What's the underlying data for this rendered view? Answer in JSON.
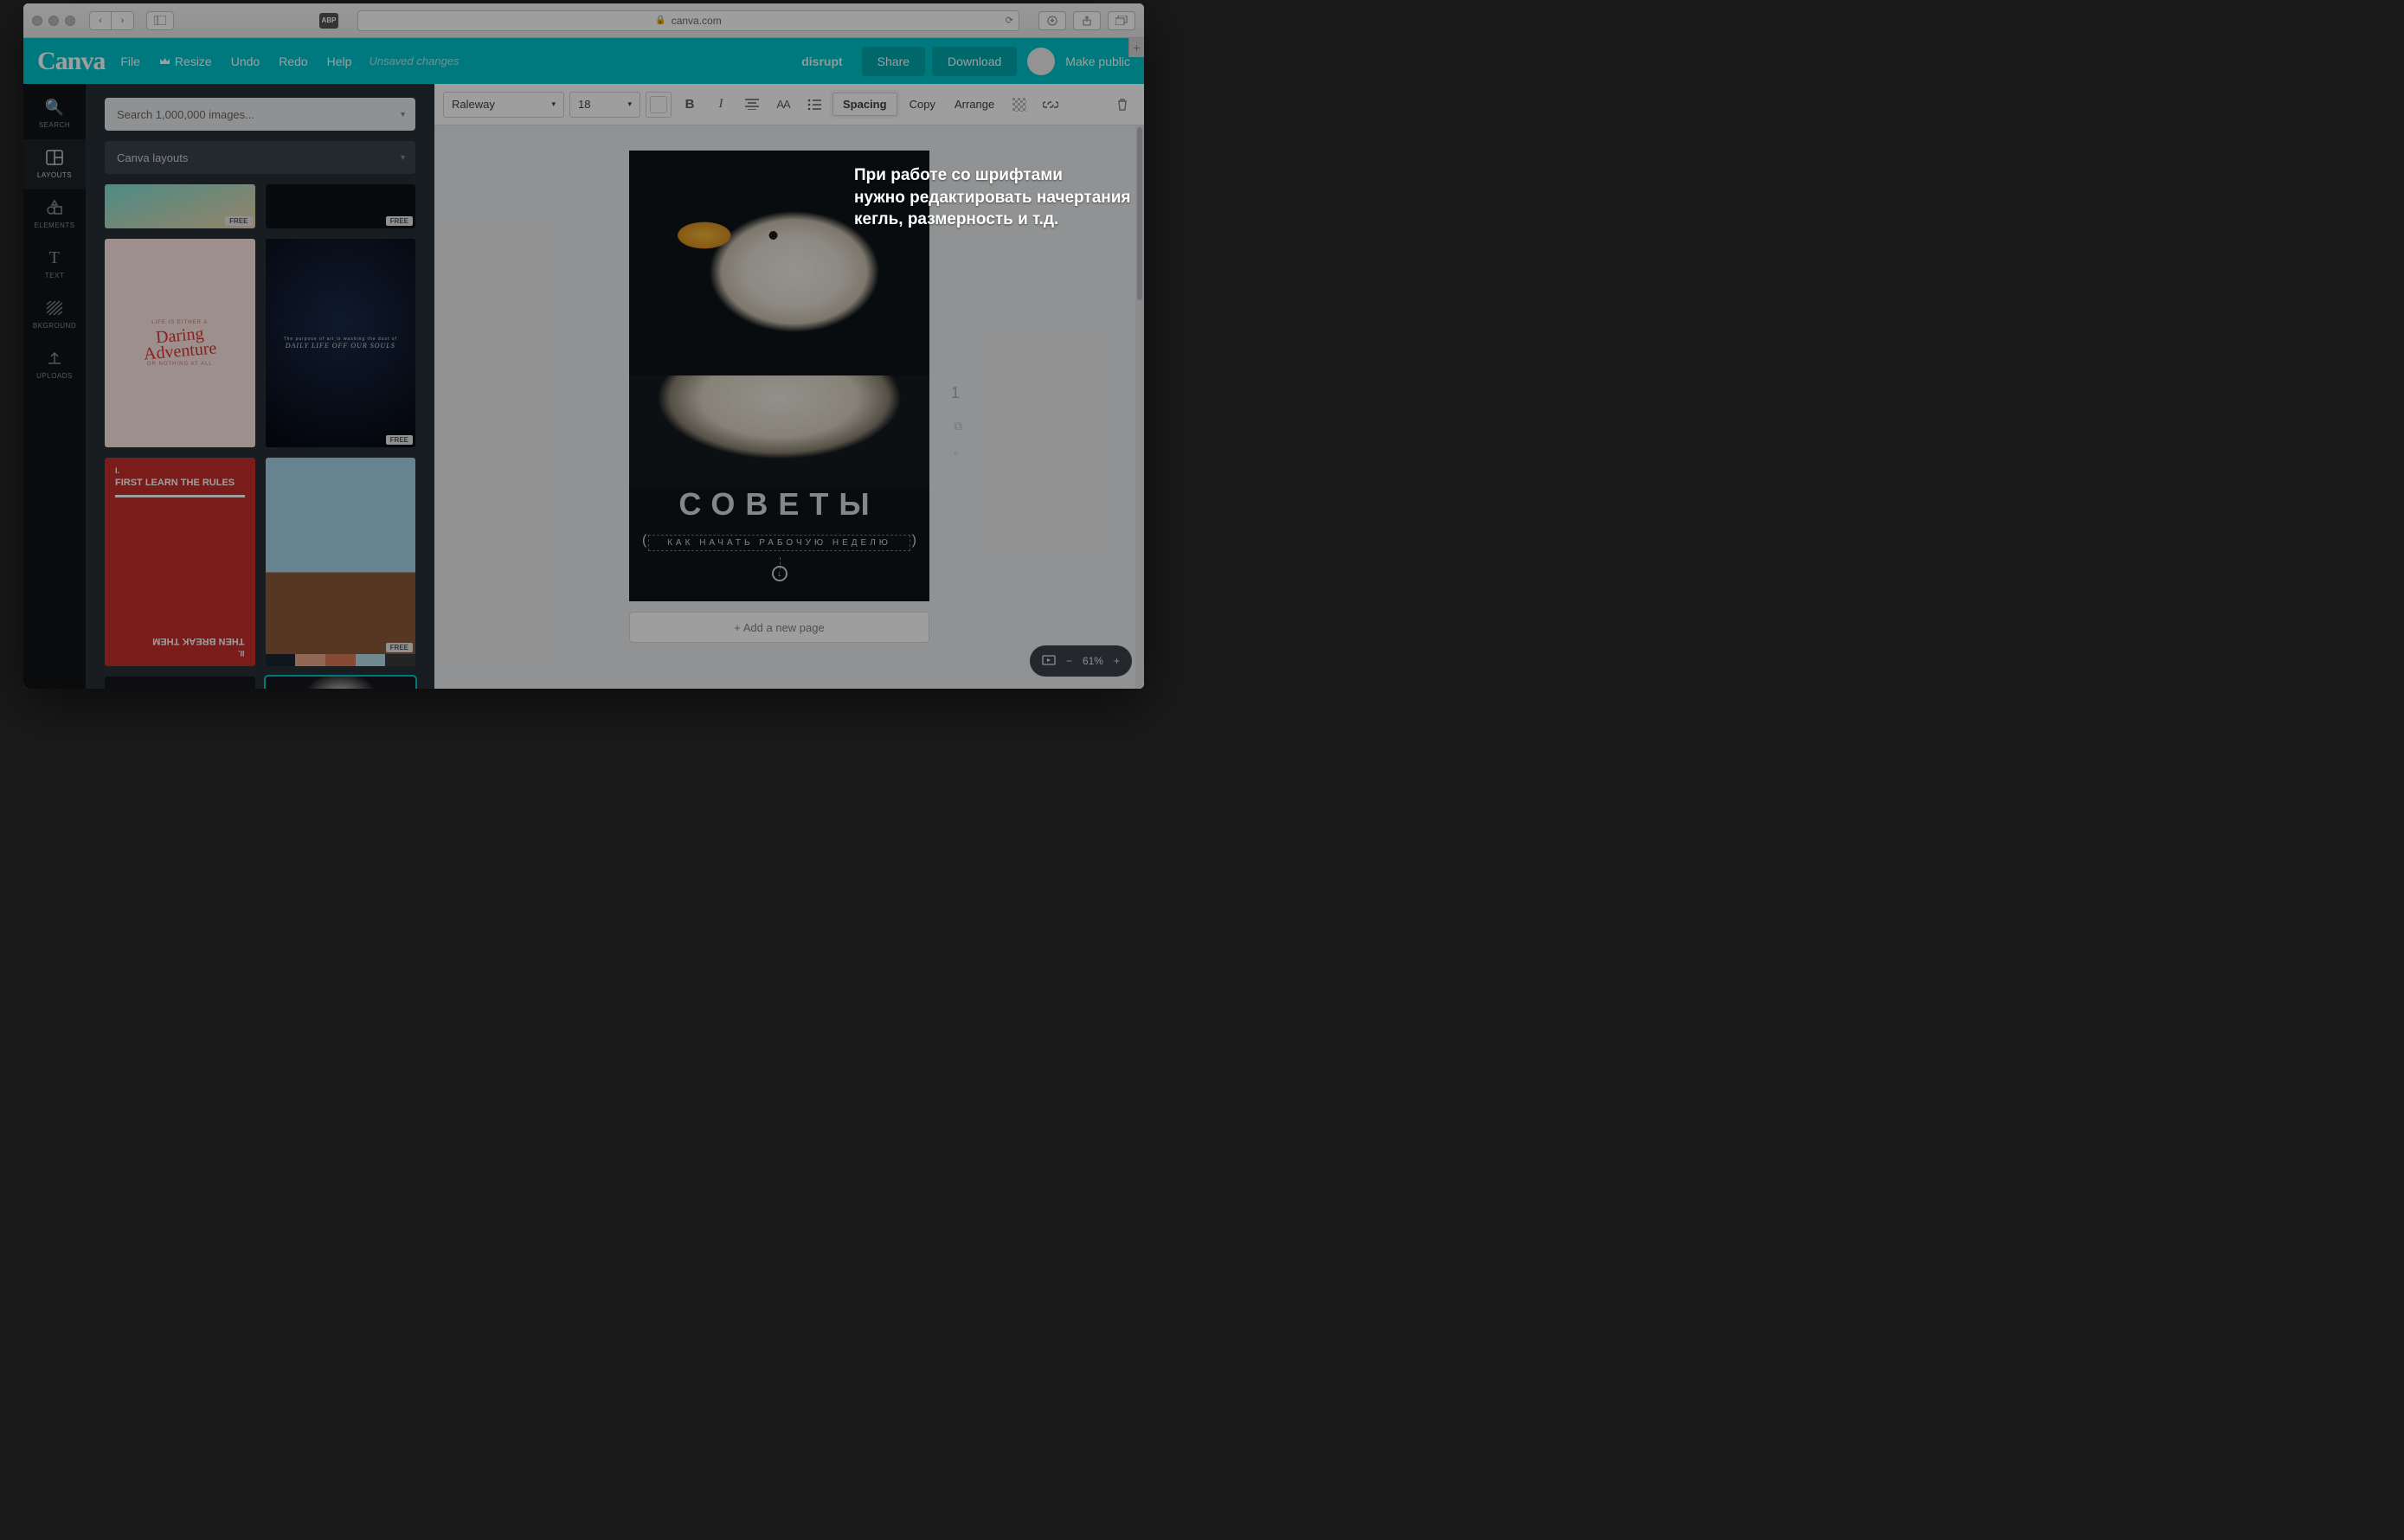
{
  "browser": {
    "url_host": "canva.com",
    "abp": "ABP"
  },
  "topbar": {
    "logo": "Canva",
    "file": "File",
    "resize": "Resize",
    "undo": "Undo",
    "redo": "Redo",
    "help": "Help",
    "unsaved": "Unsaved changes",
    "project": "disrupt",
    "share": "Share",
    "download": "Download",
    "make_public": "Make public"
  },
  "sidenav": {
    "search": "SEARCH",
    "layouts": "LAYOUTS",
    "elements": "ELEMENTS",
    "text": "TEXT",
    "bkground": "BKGROUND",
    "uploads": "UPLOADS"
  },
  "leftpanel": {
    "search_placeholder": "Search 1,000,000 images...",
    "layouts_label": "Canva layouts",
    "free_badge": "FREE",
    "thumbs": {
      "t2_top": "LIFE IS EITHER A",
      "t2_script1": "Daring",
      "t2_script2": "Adventure",
      "t2_bottom": "OR NOTHING AT ALL",
      "t3_top": "The purpose of art is washing the dust of",
      "t3_main": "DAILY LIFE OFF OUR SOULS",
      "t4_i": "I.",
      "t4_a": "FIRST LEARN THE RULES",
      "t4_ii": "II.",
      "t4_b": "THEN BREAK THEM"
    }
  },
  "propbar": {
    "font": "Raleway",
    "size": "18",
    "spacing": "Spacing",
    "copy": "Copy",
    "arrange": "Arrange"
  },
  "artboard": {
    "title": "СОВЕТЫ",
    "subtitle": "КАК НАЧАТЬ РАБОЧУЮ НЕДЕЛЮ",
    "page_number": "1",
    "add_page": "+ Add a new page"
  },
  "zoom": {
    "percent": "61%"
  },
  "annotation": {
    "l1": "При работе со шрифтами",
    "l2": "нужно редактировать начертания",
    "l3": "кегль, размерность и т.д."
  }
}
